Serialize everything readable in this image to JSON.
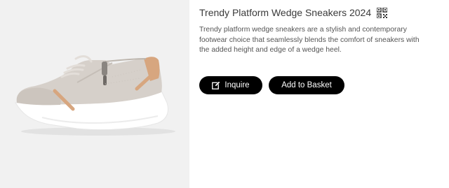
{
  "product": {
    "title": "Trendy Platform Wedge Sneakers 2024",
    "description": "Trendy platform wedge sneakers are a stylish and contemporary footwear choice that seamlessly blends the comfort of sneakers with the added height and edge of a wedge heel.",
    "image_icon": "sneaker-photo",
    "qr_icon": "qr-code-icon"
  },
  "actions": {
    "inquire_label": "Inquire",
    "inquire_icon": "edit-icon",
    "basket_label": "Add to Basket"
  },
  "colors": {
    "button_bg": "#000000",
    "button_text": "#ffffff",
    "image_bg": "#f1f1f1",
    "shoe_upper": "#d6d0ca",
    "shoe_accent": "#d7a67f",
    "sole": "#ffffff"
  }
}
